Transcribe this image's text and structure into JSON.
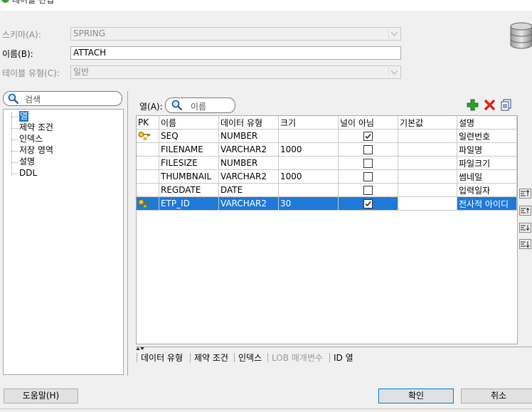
{
  "window": {
    "title": "테이블 편집"
  },
  "form": {
    "schema_label": "스키마(A):",
    "schema_value": "SPRING",
    "name_label": "이름(B):",
    "name_value": "ATTACH",
    "type_label": "테이블 유형(C):",
    "type_value": "일반"
  },
  "left": {
    "search_placeholder": "검색",
    "nav": [
      {
        "label": "열",
        "selected": true
      },
      {
        "label": "제약 조건"
      },
      {
        "label": "인덱스"
      },
      {
        "label": "저장 영역"
      },
      {
        "label": "설명"
      },
      {
        "label": "DDL"
      }
    ]
  },
  "columns_panel": {
    "label": "열(A):",
    "search_placeholder": "이름",
    "headers": [
      "PK",
      "이름",
      "데이터 유형",
      "크기",
      "널이 아님",
      "기본값",
      "설명"
    ],
    "rows": [
      {
        "pk": true,
        "name": "SEQ",
        "type": "NUMBER",
        "size": "",
        "not_null": true,
        "default": "",
        "desc": "일련번호"
      },
      {
        "pk": false,
        "name": "FILENAME",
        "type": "VARCHAR2",
        "size": "1000",
        "not_null": false,
        "default": "",
        "desc": "파일명"
      },
      {
        "pk": false,
        "name": "FILESIZE",
        "type": "NUMBER",
        "size": "",
        "not_null": false,
        "default": "",
        "desc": "파일크기"
      },
      {
        "pk": false,
        "name": "THUMBNAIL",
        "type": "VARCHAR2",
        "size": "1000",
        "not_null": false,
        "default": "",
        "desc": "썸네일"
      },
      {
        "pk": false,
        "name": "REGDATE",
        "type": "DATE",
        "size": "",
        "not_null": false,
        "default": "",
        "desc": "입력일자"
      },
      {
        "pk": true,
        "name": "ETP_ID",
        "type": "VARCHAR2",
        "size": "30",
        "not_null": true,
        "default": "",
        "desc": "전사적 아이디",
        "selected": true
      }
    ]
  },
  "bottom_tabs": [
    {
      "label": "데이터 유형",
      "enabled": true
    },
    {
      "label": "제약 조건",
      "enabled": true
    },
    {
      "label": "인덱스",
      "enabled": true
    },
    {
      "label": "LOB 매개변수",
      "enabled": false
    },
    {
      "label": "ID 열",
      "enabled": true
    }
  ],
  "buttons": {
    "help": "도움말(H)",
    "ok": "확인",
    "cancel": "취소"
  },
  "colors": {
    "selection": "#1e7ad6",
    "add": "#2ea02e",
    "delete": "#d8261c"
  }
}
